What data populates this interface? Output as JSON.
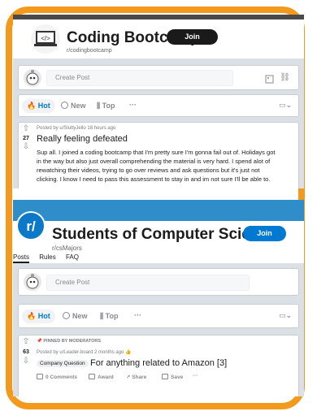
{
  "screenshot1": {
    "community_name": "Coding Bootcamp",
    "community_handle": "r/codingbootcamp",
    "join_label": "Join",
    "create_post_placeholder": "Create Post",
    "sort": {
      "hot": "Hot",
      "new": "New",
      "top": "Top",
      "more": "···"
    },
    "post": {
      "meta": "Posted by u/SluttyJello 18 hours ago",
      "votes": "27",
      "title": "Really feeling defeated",
      "body": "Sup all. I joined a coding bootcamp that I'm pretty sure I'm gonna fail out of. Holidays got in the way but also just overall comprehending the material is very hard. I spend alot of rewatching their videos, trying to go over reviews and ask questions but it's just not clicking. I know I need to pass this assessment to stay in and im not sure I'll be able to."
    }
  },
  "screenshot2": {
    "logo_text": "r/",
    "community_name": "Students of Computer Science!",
    "community_handle": "r/csMajors",
    "join_label": "Join",
    "tabs": [
      "Posts",
      "Rules",
      "FAQ"
    ],
    "create_post_placeholder": "Create Post",
    "sort": {
      "hot": "Hot",
      "new": "New",
      "top": "Top",
      "more": "···"
    },
    "post": {
      "pinned": "PINNED BY MODERATORS",
      "votes": "63",
      "meta": "Posted by u/Leader-board 2 months ago",
      "flair": "Company Question",
      "title": "For anything related to Amazon [3]",
      "comments": "0 Comments",
      "award": "Award",
      "share": "Share",
      "save": "Save",
      "more": "···"
    }
  },
  "colors": {
    "frame": "#f39a1d",
    "accent_blue": "#0079d3",
    "banner_blue": "#2f8ec9"
  }
}
